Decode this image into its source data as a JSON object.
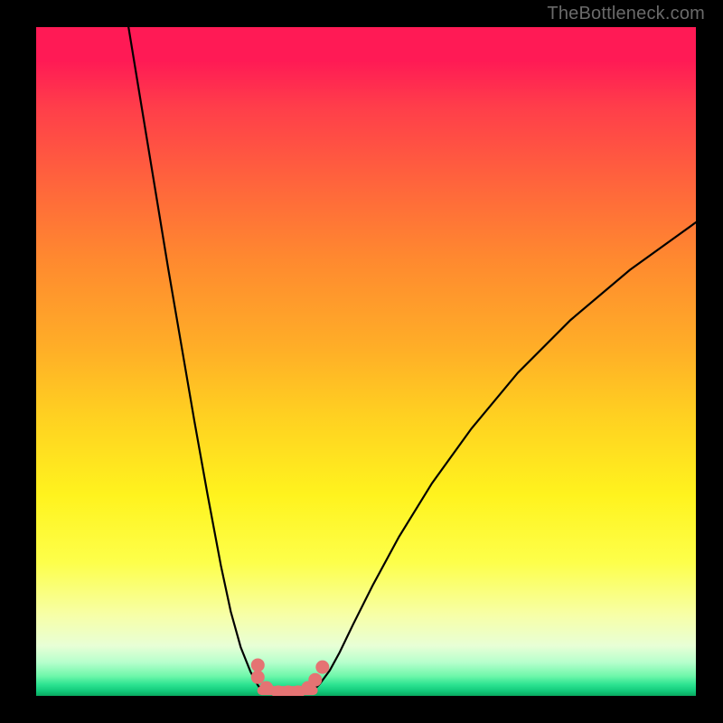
{
  "watermark": "TheBottleneck.com",
  "chart_data": {
    "type": "line",
    "title": "",
    "xlabel": "",
    "ylabel": "",
    "xlim": [
      0,
      100
    ],
    "ylim": [
      0,
      100
    ],
    "grid": false,
    "legend": false,
    "series": [
      {
        "name": "left-branch",
        "x": [
          14,
          16,
          18,
          20,
          22,
          24,
          26,
          28,
          29.5,
          31,
          32.5,
          33.6,
          34.2
        ],
        "values": [
          100,
          88,
          76,
          64,
          52.5,
          41,
          30,
          19.5,
          12.6,
          7.3,
          3.6,
          1.6,
          0.8
        ]
      },
      {
        "name": "right-branch",
        "x": [
          42,
          43,
          44.5,
          46,
          48,
          51,
          55,
          60,
          66,
          73,
          81,
          90,
          100
        ],
        "values": [
          0.8,
          1.8,
          3.8,
          6.5,
          10.6,
          16.5,
          23.8,
          31.8,
          40,
          48.3,
          56.2,
          63.7,
          70.8
        ]
      },
      {
        "name": "minimum-plateau",
        "x": [
          34.2,
          42
        ],
        "values": [
          0.8,
          0.8
        ]
      }
    ],
    "markers": [
      {
        "x": 33.6,
        "y": 4.6
      },
      {
        "x": 33.6,
        "y": 2.8
      },
      {
        "x": 34.9,
        "y": 1.2
      },
      {
        "x": 36.7,
        "y": 0.55
      },
      {
        "x": 38.2,
        "y": 0.55
      },
      {
        "x": 39.7,
        "y": 0.55
      },
      {
        "x": 41.2,
        "y": 1.2
      },
      {
        "x": 42.3,
        "y": 2.4
      },
      {
        "x": 43.4,
        "y": 4.3
      }
    ],
    "marker_color": "#e57373",
    "curve_color": "#000000"
  }
}
